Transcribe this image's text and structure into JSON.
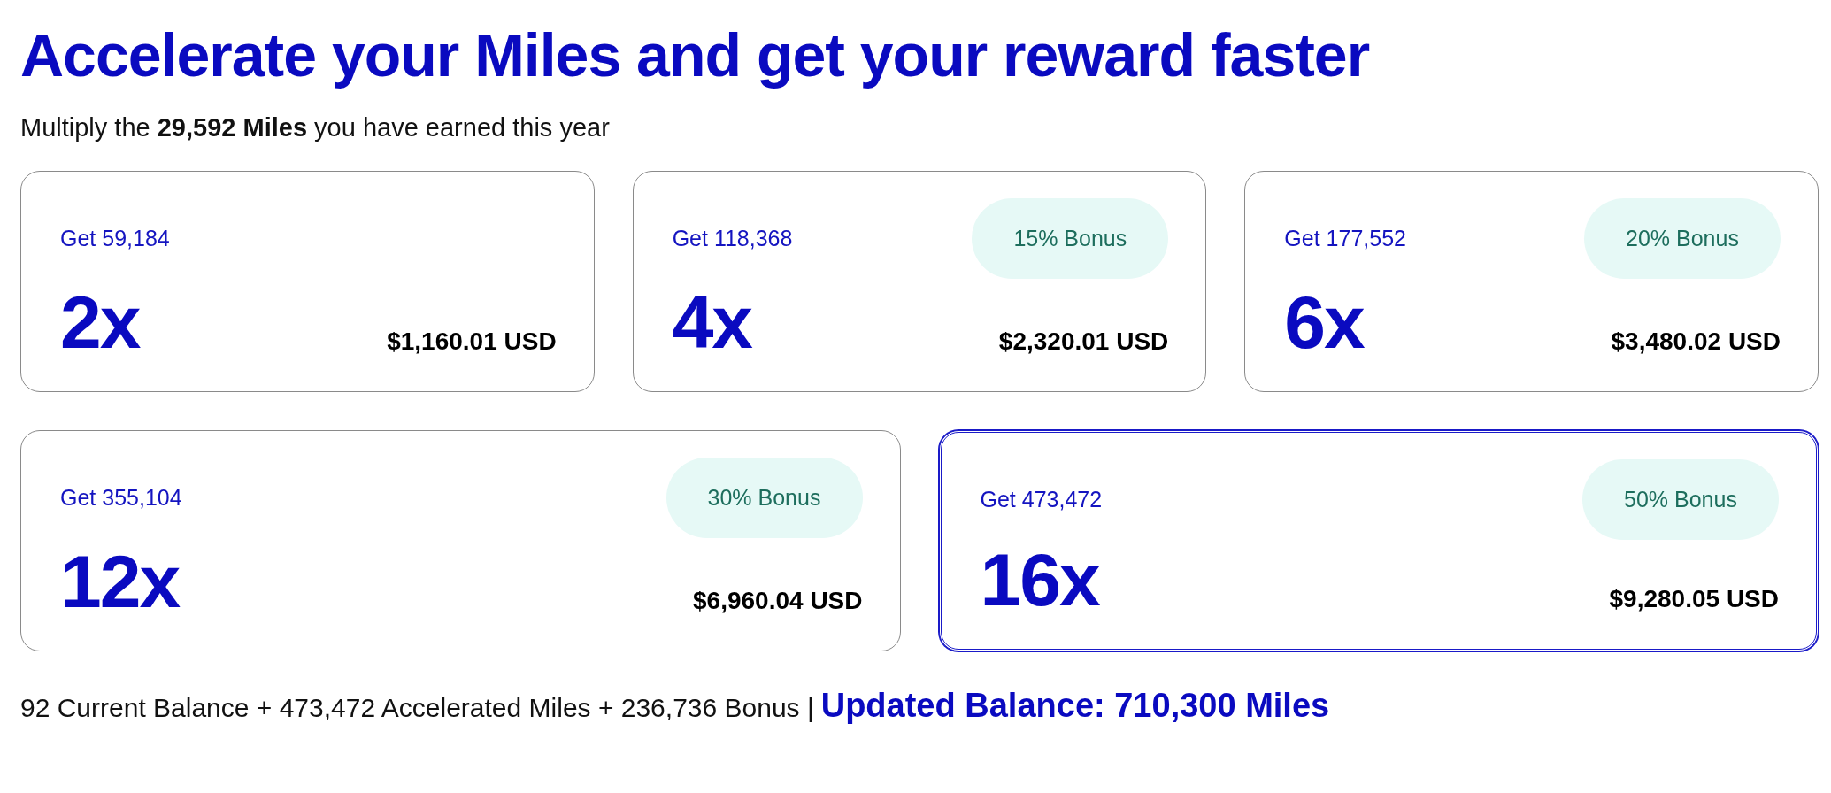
{
  "title": "Accelerate your Miles and get your reward faster",
  "subtitle": "Multiply the **29,592 Miles** you have earned this year",
  "options": [
    {
      "get": "Get 59,184",
      "multiplier": "2x",
      "price": "$1,160.01 USD",
      "selected": false
    },
    {
      "get": "Get 118,368",
      "bonus": "15% Bonus",
      "multiplier": "4x",
      "price": "$2,320.01 USD",
      "selected": false
    },
    {
      "get": "Get 177,552",
      "bonus": "20% Bonus",
      "multiplier": "6x",
      "price": "$3,480.02 USD",
      "selected": false
    },
    {
      "get": "Get 355,104",
      "bonus": "30% Bonus",
      "multiplier": "12x",
      "price": "$6,960.04 USD",
      "selected": false
    },
    {
      "get": "Get 473,472",
      "bonus": "50% Bonus",
      "multiplier": "16x",
      "price": "$9,280.05 USD",
      "selected": true
    }
  ],
  "summary": {
    "breakdown": "92 Current Balance + 473,472 Accelerated Miles + 236,736 Bonus |",
    "updated_balance": "Updated Balance: 710,300 Miles"
  }
}
